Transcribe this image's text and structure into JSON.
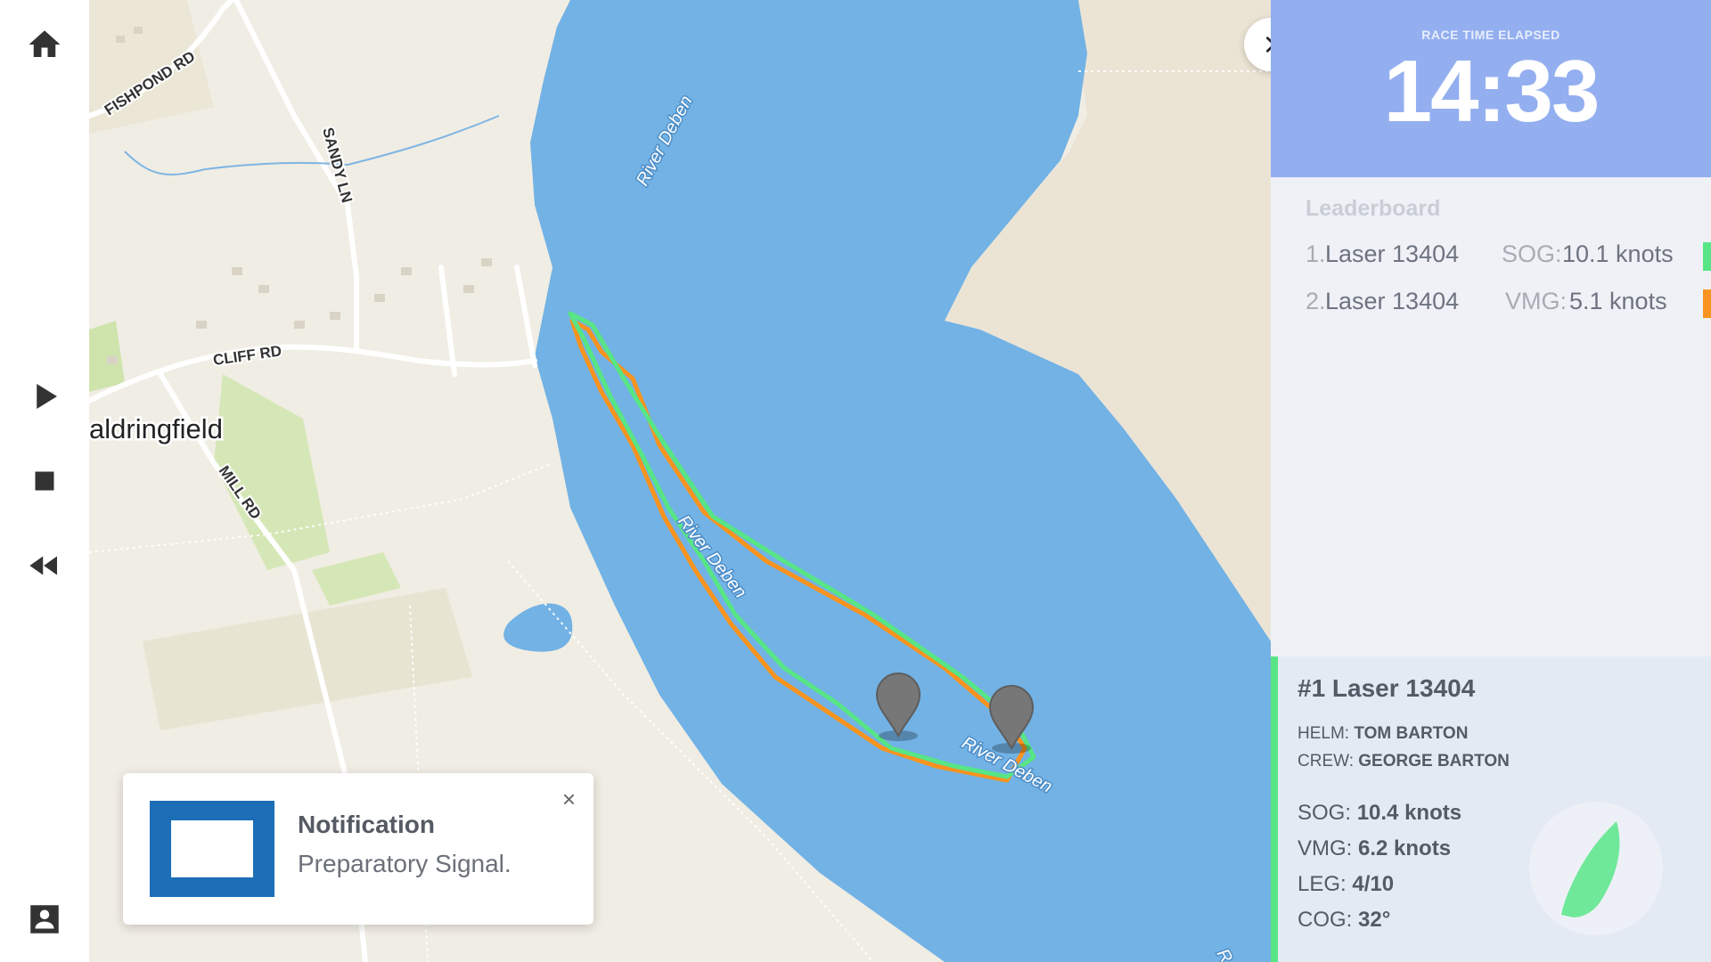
{
  "sidebar": {
    "icons": [
      "home-icon",
      "play-icon",
      "stop-icon",
      "rewind-icon",
      "profile-icon"
    ]
  },
  "map": {
    "labels": {
      "fishpond_rd": "FISHPOND RD",
      "sandy_ln": "SANDY LN",
      "cliff_rd": "CLIFF RD",
      "waldringfield": "aldringfield",
      "mill_rd": "MILL RD",
      "river_top": "River Deben",
      "river_mid": "River Deben",
      "river_low": "River Deben",
      "river_edge": "R"
    },
    "track_colors": {
      "leader": "#57e585",
      "second": "#f7931e"
    }
  },
  "timer": {
    "label": "RACE TIME ELAPSED",
    "value": "14:33"
  },
  "leaderboard": {
    "title": "Leaderboard",
    "rows": [
      {
        "rank": "1.",
        "boat": "Laser 13404",
        "stat_label": "SOG:",
        "stat_value": "10.1 knots",
        "color": "#57e585"
      },
      {
        "rank": "2.",
        "boat": "Laser 13404",
        "stat_label": "VMG:",
        "stat_value": "5.1 knots",
        "color": "#f7931e"
      }
    ]
  },
  "detail": {
    "title": "#1 Laser 13404",
    "helm_label": "HELM:",
    "helm_value": "TOM BARTON",
    "crew_label": "CREW:",
    "crew_value": "GEORGE BARTON",
    "stats": [
      {
        "label": "SOG:",
        "value": "10.4 knots"
      },
      {
        "label": "VMG:",
        "value": "6.2 knots"
      },
      {
        "label": "LEG:",
        "value": "4/10"
      },
      {
        "label": "COG:",
        "value": "32°"
      }
    ],
    "accent_color": "#57e585"
  },
  "notification": {
    "title": "Notification",
    "body": "Preparatory Signal.",
    "close": "×"
  }
}
